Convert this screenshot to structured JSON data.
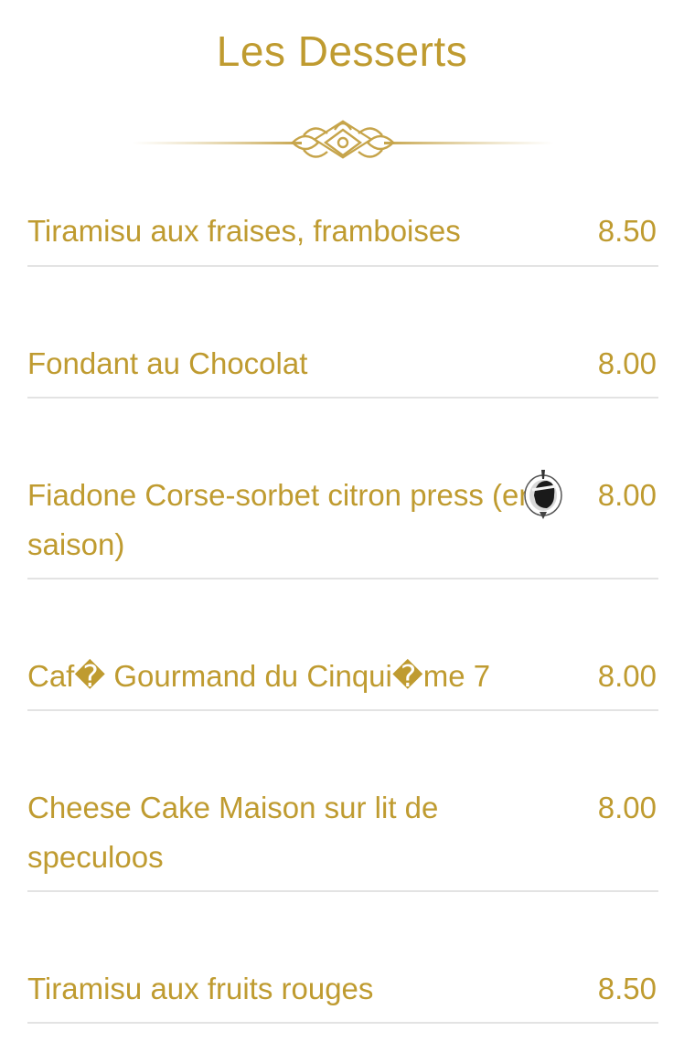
{
  "header": {
    "title": "Les Desserts",
    "ornament_icon": "gold-filigree-divider-icon"
  },
  "menu": {
    "items": [
      {
        "name": "Tiramisu aux fraises, framboises",
        "price": "8.50"
      },
      {
        "name": "Fondant au Chocolat",
        "price": "8.00"
      },
      {
        "name": "Fiadone Corse-sorbet citron press (en saison)",
        "price": "8.00",
        "icon": "corsican-moor-head-icon"
      },
      {
        "name": "Caf� Gourmand du Cinqui�me 7",
        "price": "8.00"
      },
      {
        "name": "Cheese Cake Maison sur lit de speculoos",
        "price": "8.00"
      },
      {
        "name": "Tiramisu aux fruits rouges",
        "price": "8.50"
      }
    ]
  },
  "colors": {
    "gold": "#bf9b30",
    "divider": "#e3e3e3",
    "background": "#ffffff"
  }
}
